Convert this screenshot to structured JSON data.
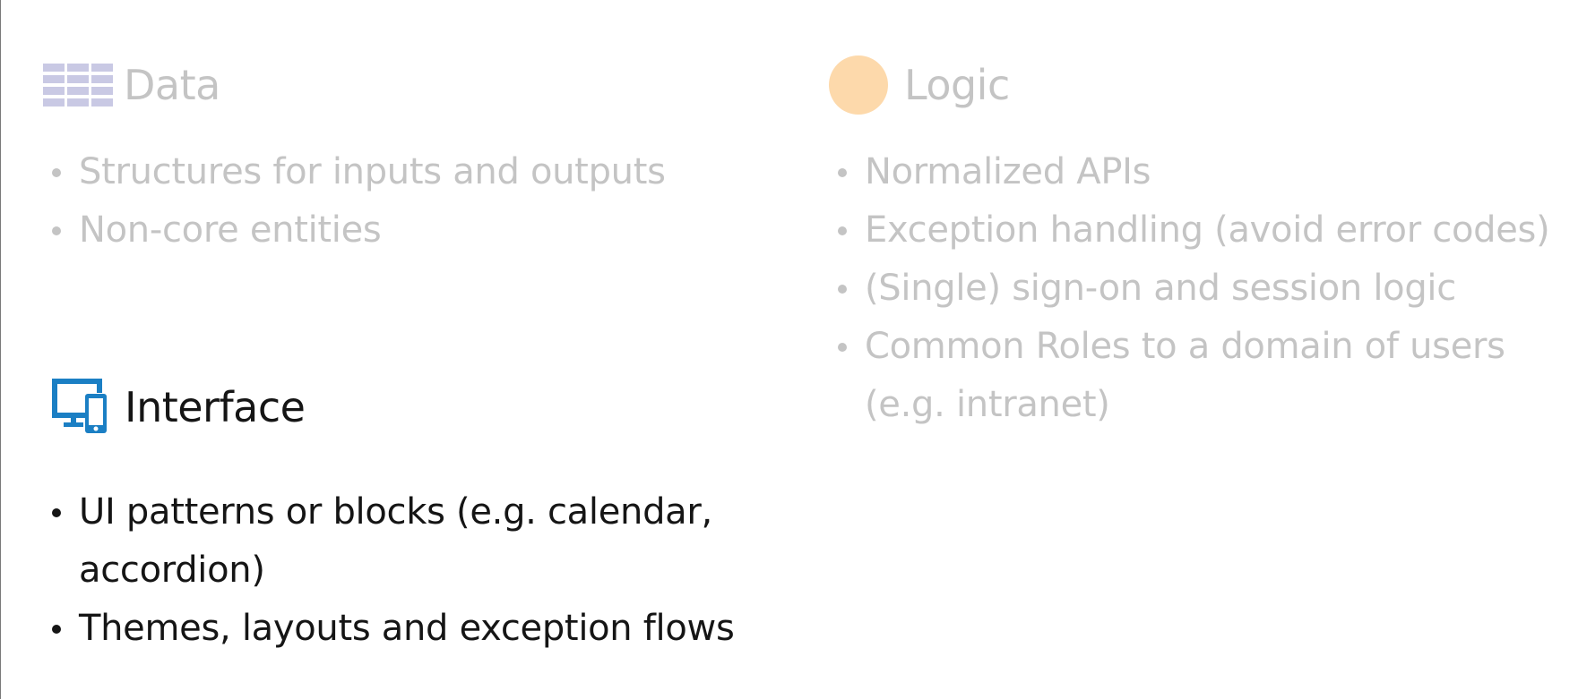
{
  "sections": {
    "data": {
      "icon": "grid-table-icon",
      "icon_color": "#c9c9e4",
      "title": "Data",
      "items": [
        "Structures for inputs and outputs",
        "Non-core entities"
      ]
    },
    "logic": {
      "icon": "circle-icon",
      "icon_color": "#fdd9ab",
      "title": "Logic",
      "items": [
        "Normalized APIs",
        "Exception handling (avoid error codes)",
        "(Single) sign-on and session logic",
        "Common Roles to a domain of users",
        "(e.g. intranet)"
      ]
    },
    "interface": {
      "icon": "monitor-phone-icon",
      "icon_color": "#1b7fc4",
      "title": "Interface",
      "items": [
        "UI patterns or blocks (e.g. calendar,",
        "accordion)",
        "Themes, layouts and exception flows"
      ]
    }
  },
  "colors": {
    "muted_text": "#c4c4c4",
    "active_text": "#151515"
  }
}
